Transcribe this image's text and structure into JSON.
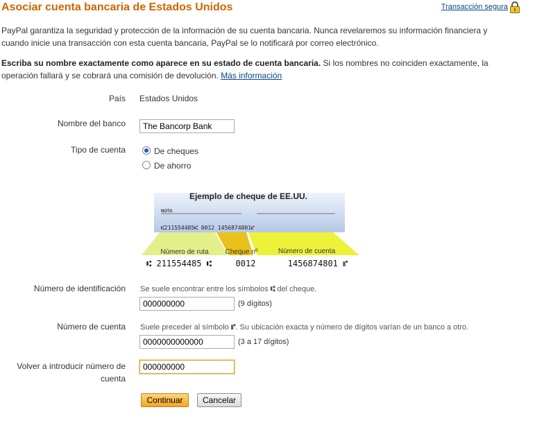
{
  "page": {
    "title": "Asociar cuenta bancaria de Estados Unidos",
    "secure_link": "Transacción segura",
    "lock_icon": "padlock-icon"
  },
  "intro": "PayPal garantiza la seguridad y protección de la información de su cuenta bancaria. Nunca revelaremos su información financiera y cuando inicie una transacción con esta cuenta bancaria, PayPal se lo notificará por correo electrónico.",
  "warning": {
    "bold": "Escriba su nombre exactamente como aparece en su estado de cuenta bancaria.",
    "text": " Si los nombres no coinciden exactamente, la operación fallará y se cobrará una comisión de devolución. ",
    "link": "Más información"
  },
  "form": {
    "country_label": "País",
    "country_value": "Estados Unidos",
    "bank_label": "Nombre del banco",
    "bank_value": "The Bancorp Bank",
    "type_label": "Tipo de cuenta",
    "type_options": [
      "De cheques",
      "De ahorro"
    ],
    "type_selected": "De cheques",
    "routing_label": "Número de identificación",
    "routing_hint_pre": "Se suele encontrar entre los símbolos",
    "routing_hint_post": "del cheque.",
    "routing_value": "000000000",
    "routing_digits": "(9 dígitos)",
    "account_label": "Número de cuenta",
    "account_hint_pre": "Suele preceder al símbolo",
    "account_hint_post": ". Su ubicación exacta y número de dígitos varían de un banco a otro.",
    "account_value": "0000000000000",
    "account_digits": "(3 a 17 dígitos)",
    "reenter_label_1": "Volver a introducir número de",
    "reenter_label_2": "cuenta",
    "reenter_value": "000000000"
  },
  "check": {
    "title": "Ejemplo de cheque de EE.UU.",
    "memo": "NOTA",
    "micr_line": "⑆211554485⑆  0012   1456874801⑈",
    "routing_tab": "Número de ruta",
    "check_tab": "Cheque nº",
    "account_tab": "Número de cuenta",
    "routing_number": "⑆ 211554485 ⑆",
    "check_number": "0012",
    "account_number": "1456874801 ⑈",
    "colors": {
      "check_top": "#eef3fb",
      "check_bottom": "#b5c8e6",
      "routing": "#e3ef8a",
      "check_no": "#e8c21a",
      "account": "#eef13a"
    }
  },
  "buttons": {
    "continue": "Continuar",
    "cancel": "Cancelar"
  }
}
